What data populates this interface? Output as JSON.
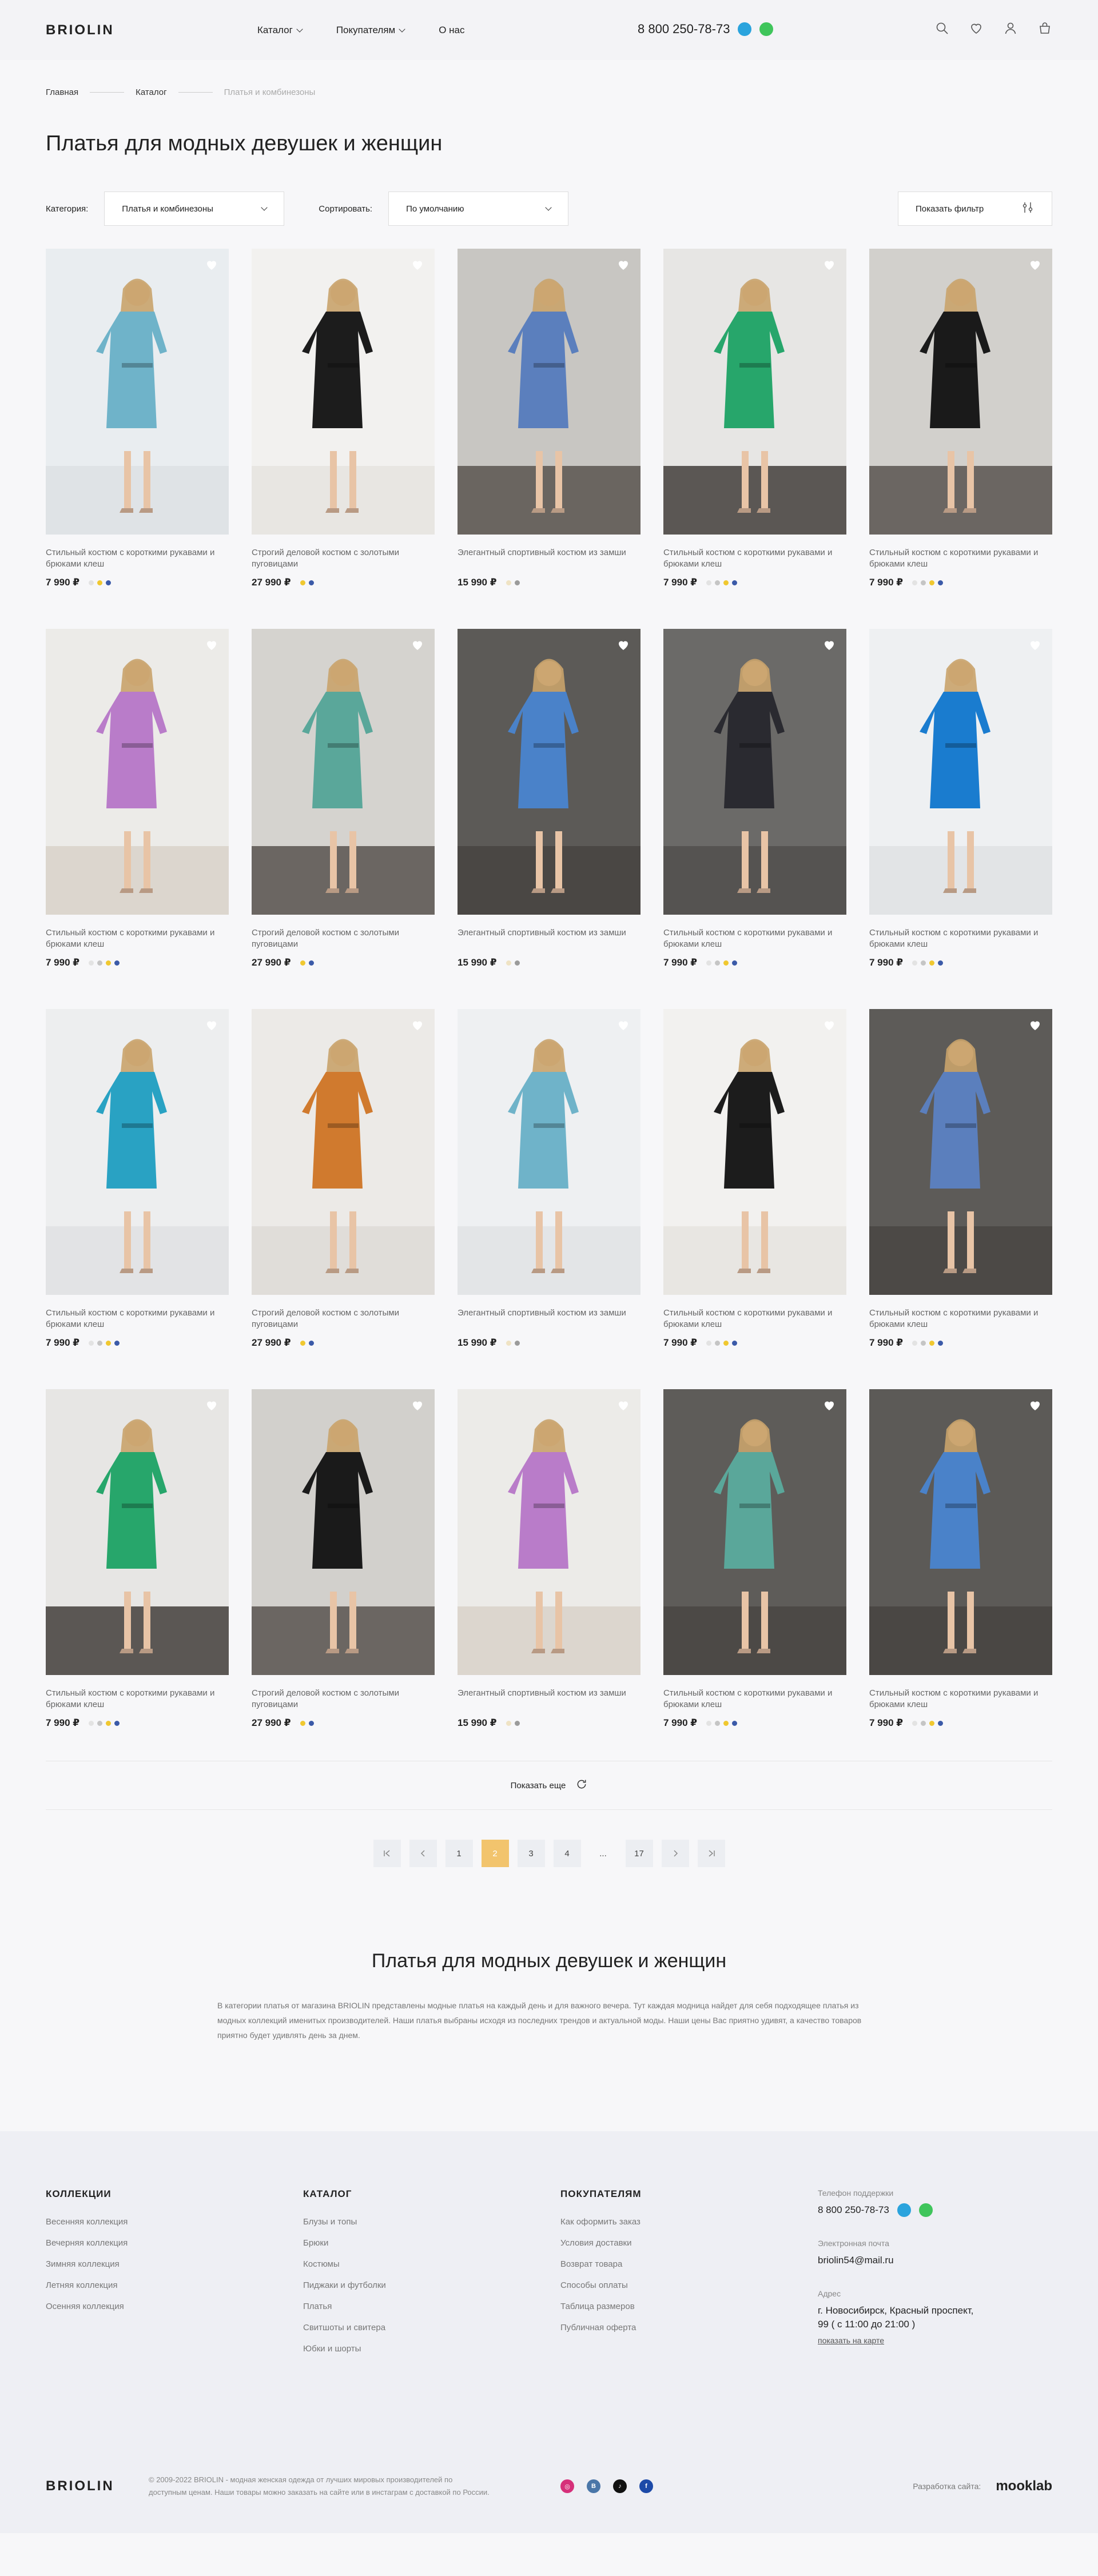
{
  "header": {
    "logo": "BRIOLIN",
    "nav": [
      "Каталог",
      "Покупателям",
      "О нас"
    ],
    "phone": "8 800 250-78-73"
  },
  "breadcrumb": [
    "Главная",
    "Каталог",
    "Платья и комбинезоны"
  ],
  "page_title": "Платья для модных девушек и женщин",
  "filters": {
    "category_label": "Категория:",
    "category_value": "Платья и комбинезоны",
    "sort_label": "Сортировать:",
    "sort_value": "По умолчанию",
    "show_filter": "Показать фильтр"
  },
  "products": [
    {
      "name": "Стильный костюм с короткими рукавами и брюками клеш",
      "price": "7 990 ₽",
      "wall": "#e9edf0",
      "floor": "#dfe3e6",
      "dress": "#6fb3c9",
      "swatches": [
        "#e3e3e3",
        "#f0c830",
        "#3b5aa8"
      ]
    },
    {
      "name": "Строгий деловой костюм с золотыми пуговицами",
      "price": "27 990 ₽",
      "wall": "#f2f1ef",
      "floor": "#e8e6e2",
      "dress": "#1c1c1c",
      "swatches": [
        "#f0c830",
        "#3b5aa8"
      ]
    },
    {
      "name": "Элегантный спортивный костюм из замши",
      "price": "15 990 ₽",
      "wall": "#c8c6c2",
      "floor": "#6a6560",
      "dress": "#5b7fbd",
      "swatches": [
        "#efe3c4",
        "#9b9b9b"
      ]
    },
    {
      "name": "Стильный костюм с короткими рукавами и брюками клеш",
      "price": "7 990 ₽",
      "wall": "#e7e6e4",
      "floor": "#5b5754",
      "dress": "#27a66b",
      "swatches": [
        "#e3e3e3",
        "#c5c5c5",
        "#f0c830",
        "#3b5aa8"
      ]
    },
    {
      "name": "Стильный костюм с короткими рукавами и брюками клеш",
      "price": "7 990 ₽",
      "wall": "#d2d0cc",
      "floor": "#6b6662",
      "dress": "#1a1a1a",
      "swatches": [
        "#e3e3e3",
        "#c5c5c5",
        "#f0c830",
        "#3b5aa8"
      ]
    },
    {
      "name": "Стильный костюм с короткими рукавами и брюками клеш",
      "price": "7 990 ₽",
      "wall": "#ecebe8",
      "floor": "#dcd6ce",
      "dress": "#b97cc9",
      "swatches": [
        "#e3e3e3",
        "#c5c5c5",
        "#f0c830",
        "#3b5aa8"
      ]
    },
    {
      "name": "Строгий деловой костюм с золотыми пуговицами",
      "price": "27 990 ₽",
      "wall": "#d5d3cf",
      "floor": "#6b6662",
      "dress": "#5aa79a",
      "swatches": [
        "#f0c830",
        "#3b5aa8"
      ]
    },
    {
      "name": "Элегантный спортивный костюм из замши",
      "price": "15 990 ₽",
      "wall": "#5c5a57",
      "floor": "#4a4744",
      "dress": "#4a82c9",
      "swatches": [
        "#efe3c4",
        "#9b9b9b"
      ]
    },
    {
      "name": "Стильный костюм с короткими рукавами и брюками клеш",
      "price": "7 990 ₽",
      "wall": "#6b6a68",
      "floor": "#555351",
      "dress": "#2a2a30",
      "swatches": [
        "#e3e3e3",
        "#c5c5c5",
        "#f0c830",
        "#3b5aa8"
      ]
    },
    {
      "name": "Стильный костюм с короткими рукавами и брюками клеш",
      "price": "7 990 ₽",
      "wall": "#eef0f2",
      "floor": "#e2e4e6",
      "dress": "#1a7ccf",
      "swatches": [
        "#e3e3e3",
        "#c5c5c5",
        "#f0c830",
        "#3b5aa8"
      ]
    },
    {
      "name": "Стильный костюм с короткими рукавами и брюками клеш",
      "price": "7 990 ₽",
      "wall": "#edeeef",
      "floor": "#e2e3e5",
      "dress": "#29a2c3",
      "swatches": [
        "#e3e3e3",
        "#c5c5c5",
        "#f0c830",
        "#3b5aa8"
      ]
    },
    {
      "name": "Строгий деловой костюм с золотыми пуговицами",
      "price": "27 990 ₽",
      "wall": "#eceae7",
      "floor": "#e0ddd9",
      "dress": "#d07a2e",
      "swatches": [
        "#f0c830",
        "#3b5aa8"
      ]
    },
    {
      "name": "Элегантный спортивный костюм из замши",
      "price": "15 990 ₽",
      "wall": "#eef0f2",
      "floor": "#e3e5e7",
      "dress": "#6fb3c9",
      "swatches": [
        "#efe3c4",
        "#9b9b9b"
      ]
    },
    {
      "name": "Стильный костюм с короткими рукавами и брюками клеш",
      "price": "7 990 ₽",
      "wall": "#f2f1ef",
      "floor": "#e8e6e2",
      "dress": "#1c1c1c",
      "swatches": [
        "#e3e3e3",
        "#c5c5c5",
        "#f0c830",
        "#3b5aa8"
      ]
    },
    {
      "name": "Стильный костюм с короткими рукавами и брюками клеш",
      "price": "7 990 ₽",
      "wall": "#5d5b58",
      "floor": "#4c4946",
      "dress": "#5b7fbd",
      "swatches": [
        "#e3e3e3",
        "#c5c5c5",
        "#f0c830",
        "#3b5aa8"
      ]
    },
    {
      "name": "Стильный костюм с короткими рукавами и брюками клеш",
      "price": "7 990 ₽",
      "wall": "#e7e6e4",
      "floor": "#5b5754",
      "dress": "#27a66b",
      "swatches": [
        "#e3e3e3",
        "#c5c5c5",
        "#f0c830",
        "#3b5aa8"
      ]
    },
    {
      "name": "Строгий деловой костюм с золотыми пуговицами",
      "price": "27 990 ₽",
      "wall": "#d2d0cc",
      "floor": "#6b6662",
      "dress": "#1a1a1a",
      "swatches": [
        "#f0c830",
        "#3b5aa8"
      ]
    },
    {
      "name": "Элегантный спортивный костюм из замши",
      "price": "15 990 ₽",
      "wall": "#ecebe8",
      "floor": "#dcd6ce",
      "dress": "#b97cc9",
      "swatches": [
        "#efe3c4",
        "#9b9b9b"
      ]
    },
    {
      "name": "Стильный костюм с короткими рукавами и брюками клеш",
      "price": "7 990 ₽",
      "wall": "#5e5c59",
      "floor": "#4c4946",
      "dress": "#5aa79a",
      "swatches": [
        "#e3e3e3",
        "#c5c5c5",
        "#f0c830",
        "#3b5aa8"
      ]
    },
    {
      "name": "Стильный костюм с короткими рукавами и брюками клеш",
      "price": "7 990 ₽",
      "wall": "#5c5a57",
      "floor": "#4a4744",
      "dress": "#4a82c9",
      "swatches": [
        "#e3e3e3",
        "#c5c5c5",
        "#f0c830",
        "#3b5aa8"
      ]
    }
  ],
  "show_more": "Показать еще",
  "pagination": {
    "pages": [
      "1",
      "2",
      "3",
      "4",
      "...",
      "17"
    ],
    "active": "2"
  },
  "seo": {
    "title": "Платья для модных девушек и женщин",
    "text": "В категории платья от магазина BRIOLIN представлены модные платья на каждый день и для важного вечера. Тут каждая модница найдет для себя подходящее платья из модных коллекций именитых производителей. Наши платья выбраны исходя из последних трендов и актуальной моды. Наши цены Вас приятно удивят, а качество товаров приятно будет удивлять день за днем."
  },
  "footer": {
    "col1": {
      "title": "КОЛЛЕКЦИИ",
      "links": [
        "Весенняя коллекция",
        "Вечерняя коллекция",
        "Зимняя коллекция",
        "Летняя коллекция",
        "Осенняя коллекция"
      ]
    },
    "col2": {
      "title": "КАТАЛОГ",
      "links": [
        "Блузы и топы",
        "Брюки",
        "Костюмы",
        "Пиджаки и футболки",
        "Платья",
        "Свитшоты и свитера",
        "Юбки и шорты"
      ]
    },
    "col3": {
      "title": "ПОКУПАТЕЛЯМ",
      "links": [
        "Как оформить заказ",
        "Условия доставки",
        "Возврат товара",
        "Способы оплаты",
        "Таблица размеров",
        "Публичная оферта"
      ]
    },
    "contacts": {
      "phone_label": "Телефон поддержки",
      "phone": "8 800 250-78-73",
      "email_label": "Электронная почта",
      "email": "briolin54@mail.ru",
      "address_label": "Адрес",
      "address": "г. Новосибирск, Красный проспект, 99 ( с 11:00 до 21:00 )",
      "map_link": "показать на карте"
    },
    "logo": "BRIOLIN",
    "copyright": "© 2009-2022 BRIOLIN - модная женская одежда от лучших мировых производителей по доступным ценам. Наши товары можно заказать на сайте или в инстаграм с доставкой по России.",
    "socials": [
      "instagram-icon",
      "vk-icon",
      "tiktok-icon",
      "facebook-icon"
    ],
    "dev_label": "Разработка сайта:",
    "dev_logo": "mooklab"
  },
  "colors": {
    "accent": "#f2c46d",
    "telegram": "#2aa3dd",
    "whatsapp": "#3fc55b"
  }
}
